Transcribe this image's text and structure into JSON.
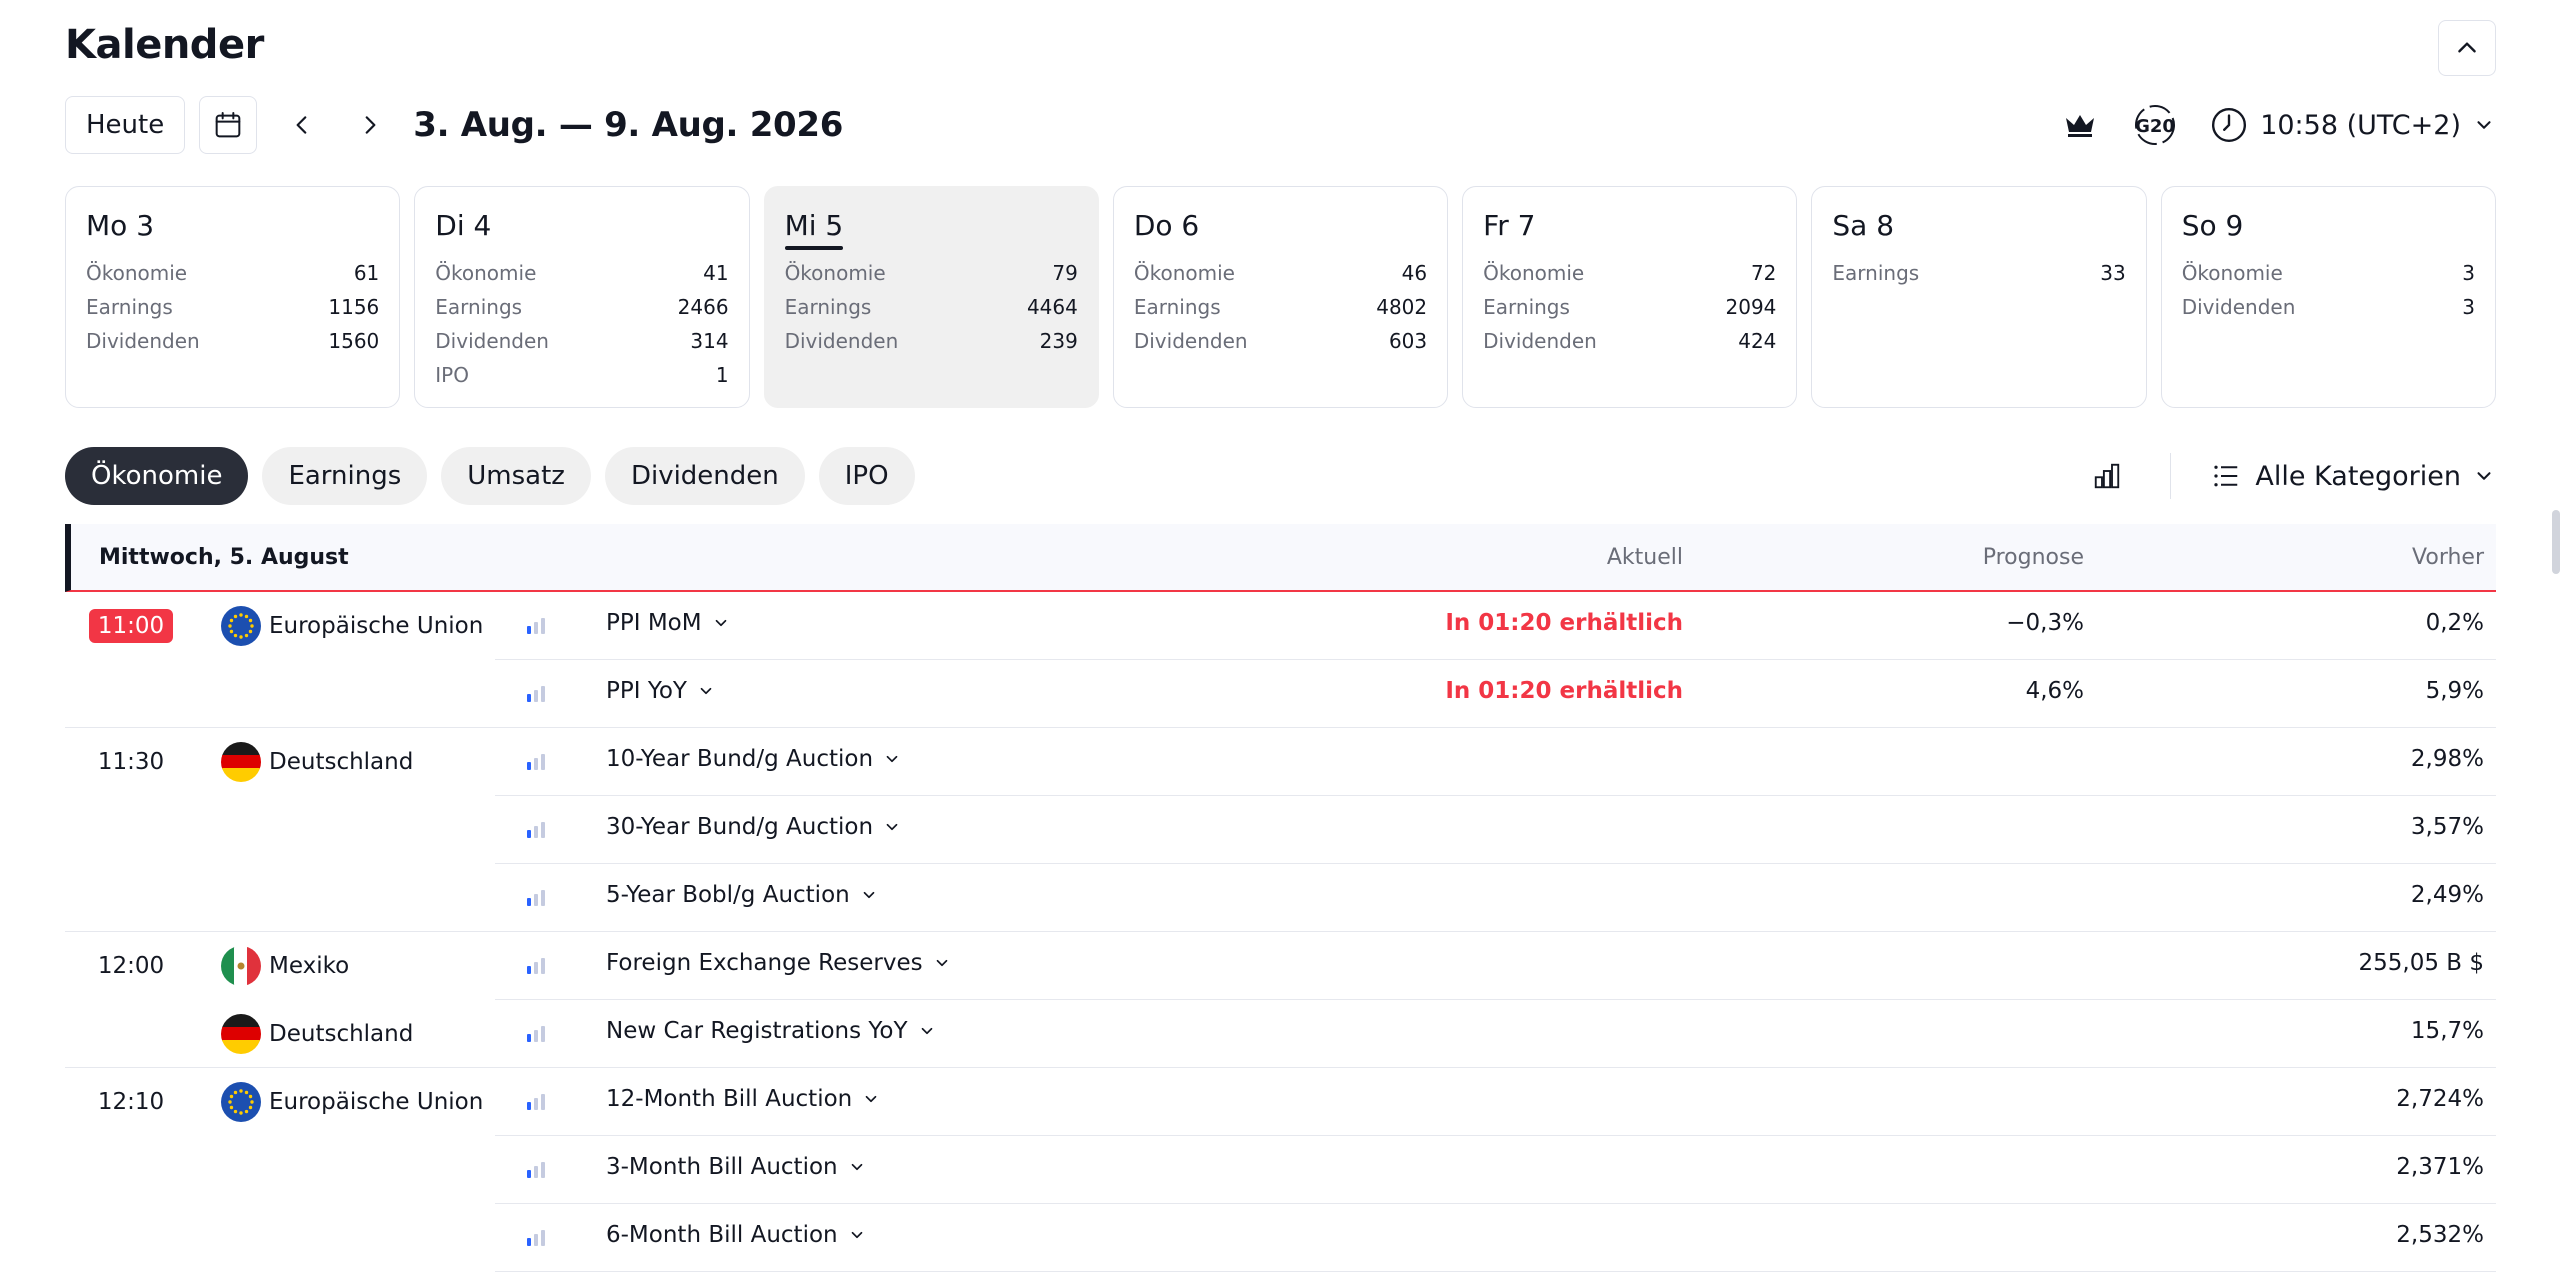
{
  "header": {
    "title": "Kalender",
    "today_label": "Heute",
    "date_range": "3. Aug. — 9. Aug. 2026",
    "g20_label": "G20",
    "time_label": "10:58 (UTC+2)"
  },
  "days": [
    {
      "name": "Mo 3",
      "active": false,
      "stats": [
        {
          "k": "Ökonomie",
          "v": "61"
        },
        {
          "k": "Earnings",
          "v": "1156"
        },
        {
          "k": "Dividenden",
          "v": "1560"
        }
      ]
    },
    {
      "name": "Di 4",
      "active": false,
      "stats": [
        {
          "k": "Ökonomie",
          "v": "41"
        },
        {
          "k": "Earnings",
          "v": "2466"
        },
        {
          "k": "Dividenden",
          "v": "314"
        },
        {
          "k": "IPO",
          "v": "1"
        }
      ]
    },
    {
      "name": "Mi 5",
      "active": true,
      "stats": [
        {
          "k": "Ökonomie",
          "v": "79"
        },
        {
          "k": "Earnings",
          "v": "4464"
        },
        {
          "k": "Dividenden",
          "v": "239"
        }
      ]
    },
    {
      "name": "Do 6",
      "active": false,
      "stats": [
        {
          "k": "Ökonomie",
          "v": "46"
        },
        {
          "k": "Earnings",
          "v": "4802"
        },
        {
          "k": "Dividenden",
          "v": "603"
        }
      ]
    },
    {
      "name": "Fr 7",
      "active": false,
      "stats": [
        {
          "k": "Ökonomie",
          "v": "72"
        },
        {
          "k": "Earnings",
          "v": "2094"
        },
        {
          "k": "Dividenden",
          "v": "424"
        }
      ]
    },
    {
      "name": "Sa 8",
      "active": false,
      "stats": [
        {
          "k": "Earnings",
          "v": "33"
        }
      ]
    },
    {
      "name": "So 9",
      "active": false,
      "stats": [
        {
          "k": "Ökonomie",
          "v": "3"
        },
        {
          "k": "Dividenden",
          "v": "3"
        }
      ]
    }
  ],
  "filters": {
    "pills": [
      {
        "label": "Ökonomie",
        "active": true
      },
      {
        "label": "Earnings",
        "active": false
      },
      {
        "label": "Umsatz",
        "active": false
      },
      {
        "label": "Dividenden",
        "active": false
      },
      {
        "label": "IPO",
        "active": false
      }
    ],
    "category_label": "Alle Kategorien"
  },
  "table": {
    "date_header": "Mittwoch, 5. August",
    "col_aktuell": "Aktuell",
    "col_prognose": "Prognose",
    "col_vorher": "Vorher",
    "rows": [
      {
        "time": "11:00",
        "hot": true,
        "country": "Europäische Union",
        "flag": "eu",
        "event": "PPI MoM",
        "aktuell": "In 01:20 erhältlich",
        "prognose": "−0,3%",
        "vorher": "0,2%",
        "full_sep": false
      },
      {
        "time": "",
        "hot": false,
        "country": "",
        "flag": "",
        "event": "PPI YoY",
        "aktuell": "In 01:20 erhältlich",
        "prognose": "4,6%",
        "vorher": "5,9%",
        "full_sep": true
      },
      {
        "time": "11:30",
        "hot": false,
        "country": "Deutschland",
        "flag": "de",
        "event": "10-Year Bund/g Auction",
        "aktuell": "",
        "prognose": "",
        "vorher": "2,98%",
        "full_sep": false
      },
      {
        "time": "",
        "hot": false,
        "country": "",
        "flag": "",
        "event": "30-Year Bund/g Auction",
        "aktuell": "",
        "prognose": "",
        "vorher": "3,57%",
        "full_sep": false
      },
      {
        "time": "",
        "hot": false,
        "country": "",
        "flag": "",
        "event": "5-Year Bobl/g Auction",
        "aktuell": "",
        "prognose": "",
        "vorher": "2,49%",
        "full_sep": true
      },
      {
        "time": "12:00",
        "hot": false,
        "country": "Mexiko",
        "flag": "mx",
        "event": "Foreign Exchange Reserves",
        "aktuell": "",
        "prognose": "",
        "vorher": "255,05 B $",
        "full_sep": false
      },
      {
        "time": "",
        "hot": false,
        "country": "Deutschland",
        "flag": "de",
        "event": "New Car Registrations YoY",
        "aktuell": "",
        "prognose": "",
        "vorher": "15,7%",
        "full_sep": true
      },
      {
        "time": "12:10",
        "hot": false,
        "country": "Europäische Union",
        "flag": "eu",
        "event": "12-Month Bill Auction",
        "aktuell": "",
        "prognose": "",
        "vorher": "2,724%",
        "full_sep": false
      },
      {
        "time": "",
        "hot": false,
        "country": "",
        "flag": "",
        "event": "3-Month Bill Auction",
        "aktuell": "",
        "prognose": "",
        "vorher": "2,371%",
        "full_sep": false
      },
      {
        "time": "",
        "hot": false,
        "country": "",
        "flag": "",
        "event": "6-Month Bill Auction",
        "aktuell": "",
        "prognose": "",
        "vorher": "2,532%",
        "full_sep": false
      }
    ]
  },
  "colors": {
    "accent_red": "#f23645",
    "importance_blue": "#2962ff",
    "active_pill": "#2a2e39"
  }
}
